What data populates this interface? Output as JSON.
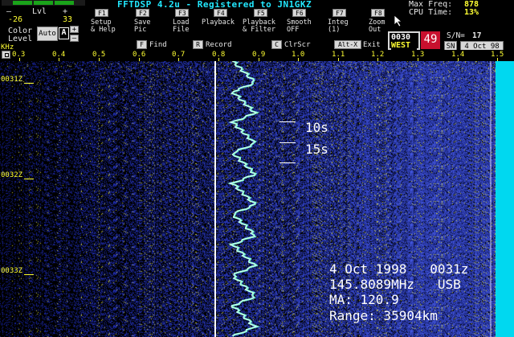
{
  "header": {
    "title": "FFTDSP 4.2u - Registered to  JN1GKZ",
    "meter_minus": "—",
    "meter_plus": "+",
    "level_label": "Lvl",
    "level_min": "-26",
    "level_max": "33",
    "color_level_label": "Color\nLevel",
    "auto_label": "Auto",
    "a_label": "A",
    "plus": "+",
    "minus": "—",
    "max_freq_label": "Max Freq:",
    "max_freq_value": "878",
    "cpu_time_label": "CPU Time:",
    "cpu_time_value": "13%"
  },
  "function_keys": [
    {
      "key": "F1",
      "label": "Setup\n& Help"
    },
    {
      "key": "F2",
      "label": "Save\nPic"
    },
    {
      "key": "F3",
      "label": "Load\nFile"
    },
    {
      "key": "F4",
      "label": "Playback"
    },
    {
      "key": "F5",
      "label": "Playback\n& Filter"
    },
    {
      "key": "F6",
      "label": "Smooth\nOFF"
    },
    {
      "key": "F7",
      "label": "Integ\n(1)"
    },
    {
      "key": "F8",
      "label": "Zoom\nOut"
    }
  ],
  "shortcuts": [
    {
      "key": "F",
      "label": "Find"
    },
    {
      "key": "R",
      "label": "Record"
    },
    {
      "key": "C",
      "label": "ClrScr"
    },
    {
      "key": "Alt-X",
      "label": "Exit"
    }
  ],
  "status": {
    "time": "0030",
    "direction": "WEST",
    "counter": "49",
    "sn_label": "S/N=",
    "sn_value": "17",
    "sn_button": "SN",
    "date_button": "4 Oct 98"
  },
  "scale": {
    "unit": "KHz",
    "tick_labels": [
      "0.3",
      "0.4",
      "0.5",
      "0.6",
      "0.7",
      "0.8",
      "0.9",
      "1.0",
      "1.1",
      "1.2",
      "1.3",
      "1.4",
      "1.5"
    ]
  },
  "waterfall": {
    "time_labels": [
      "0031Z",
      "0032Z",
      "0033Z"
    ],
    "markers": [
      "10s",
      "15s"
    ],
    "info": {
      "line1": "4 Oct 1998   0031z",
      "line2": "145.8089MHz   USB",
      "line3": "MA: 120.9",
      "line4": "Range: 35904km"
    },
    "colors": {
      "background": "#1a2aa8",
      "signal": "#7fffd4",
      "cursor": "#ffffff",
      "edge": "#00e5ff"
    }
  }
}
